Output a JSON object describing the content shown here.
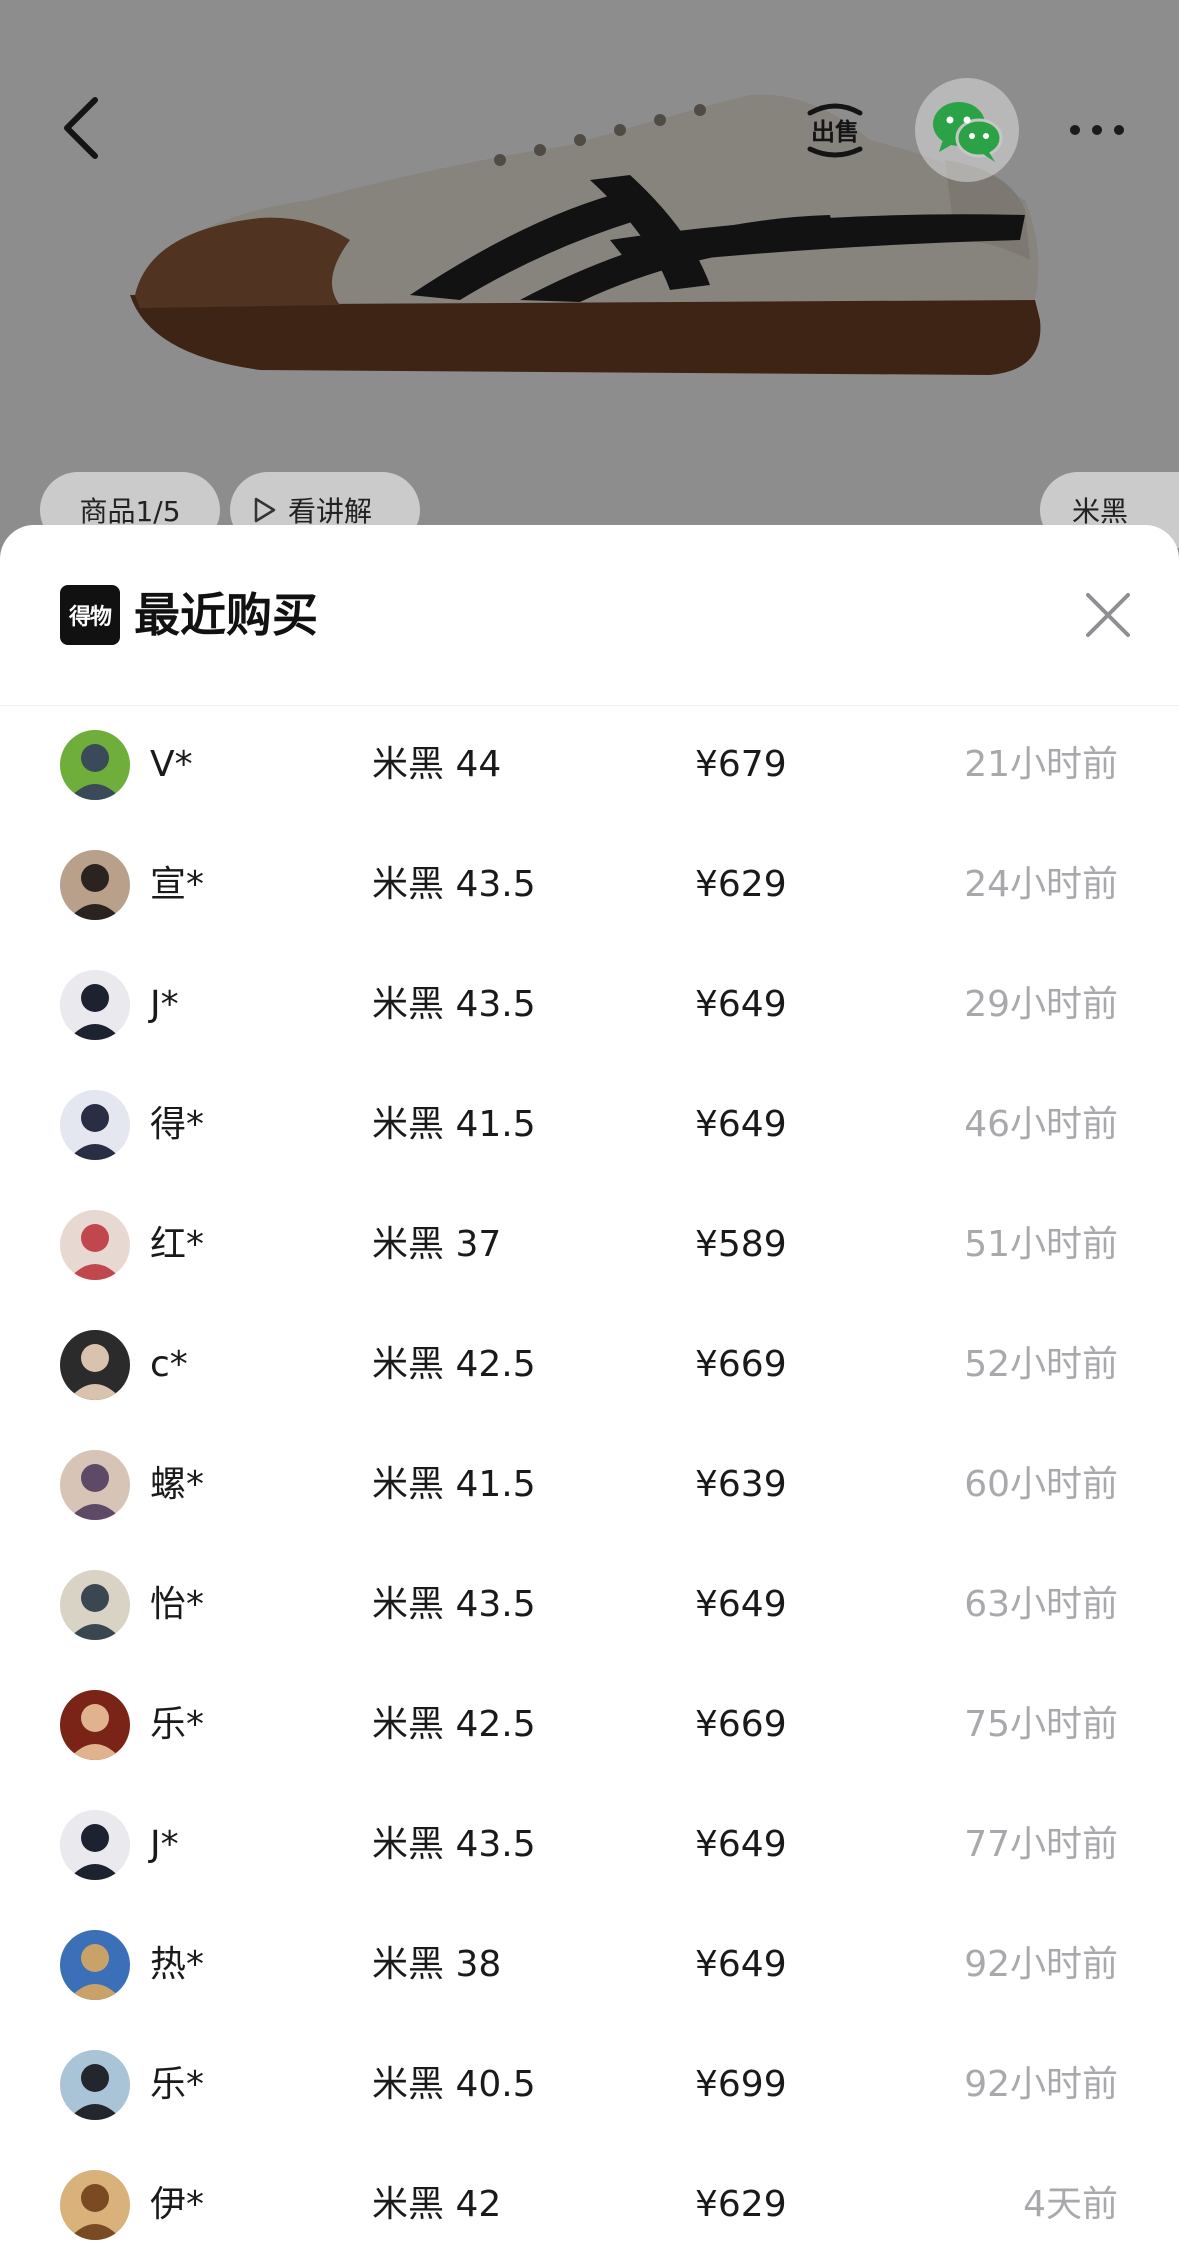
{
  "product": {
    "index_label": "商品1/5",
    "explain_label": "看讲解",
    "color_label": "米黑",
    "sell_label": "出售"
  },
  "sheet": {
    "logo_text": "得物",
    "title": "最近购买",
    "purchases": [
      {
        "name": "V*",
        "spec": "米黑 44",
        "price": "¥679",
        "time": "21小时前",
        "avatar": {
          "bg": "#6fae3a",
          "fg": "#3b4a58"
        }
      },
      {
        "name": "宣*",
        "spec": "米黑 43.5",
        "price": "¥629",
        "time": "24小时前",
        "avatar": {
          "bg": "#b8a08a",
          "fg": "#2a2320"
        }
      },
      {
        "name": "J*",
        "spec": "米黑 43.5",
        "price": "¥649",
        "time": "29小时前",
        "avatar": {
          "bg": "#e9e9ee",
          "fg": "#1d2230"
        }
      },
      {
        "name": "得*",
        "spec": "米黑 41.5",
        "price": "¥649",
        "time": "46小时前",
        "avatar": {
          "bg": "#e4e6f0",
          "fg": "#2a2e44"
        }
      },
      {
        "name": "红*",
        "spec": "米黑 37",
        "price": "¥589",
        "time": "51小时前",
        "avatar": {
          "bg": "#e8d8d2",
          "fg": "#c0474e"
        }
      },
      {
        "name": "c*",
        "spec": "米黑 42.5",
        "price": "¥669",
        "time": "52小时前",
        "avatar": {
          "bg": "#2b2b2b",
          "fg": "#d9c2ae"
        }
      },
      {
        "name": "螺*",
        "spec": "米黑 41.5",
        "price": "¥639",
        "time": "60小时前",
        "avatar": {
          "bg": "#d7c4b6",
          "fg": "#5e4a66"
        }
      },
      {
        "name": "怡*",
        "spec": "米黑 43.5",
        "price": "¥649",
        "time": "63小时前",
        "avatar": {
          "bg": "#d9d3c6",
          "fg": "#3b4750"
        }
      },
      {
        "name": "乐*",
        "spec": "米黑 42.5",
        "price": "¥669",
        "time": "75小时前",
        "avatar": {
          "bg": "#7a2418",
          "fg": "#e0b28e"
        }
      },
      {
        "name": "J*",
        "spec": "米黑 43.5",
        "price": "¥649",
        "time": "77小时前",
        "avatar": {
          "bg": "#e9e9ee",
          "fg": "#1d2230"
        }
      },
      {
        "name": "热*",
        "spec": "米黑 38",
        "price": "¥649",
        "time": "92小时前",
        "avatar": {
          "bg": "#3b6fb8",
          "fg": "#c9a26a"
        }
      },
      {
        "name": "乐*",
        "spec": "米黑 40.5",
        "price": "¥699",
        "time": "92小时前",
        "avatar": {
          "bg": "#a9c4d6",
          "fg": "#23262c"
        }
      },
      {
        "name": "伊*",
        "spec": "米黑 42",
        "price": "¥629",
        "time": "4天前",
        "avatar": {
          "bg": "#d8b27a",
          "fg": "#7a4a22"
        }
      }
    ]
  },
  "icons": {
    "back": "chevron-left-icon",
    "sell": "sell-icon",
    "wechat": "wechat-icon",
    "more": "more-dots-icon",
    "close": "close-icon",
    "play": "play-icon"
  }
}
